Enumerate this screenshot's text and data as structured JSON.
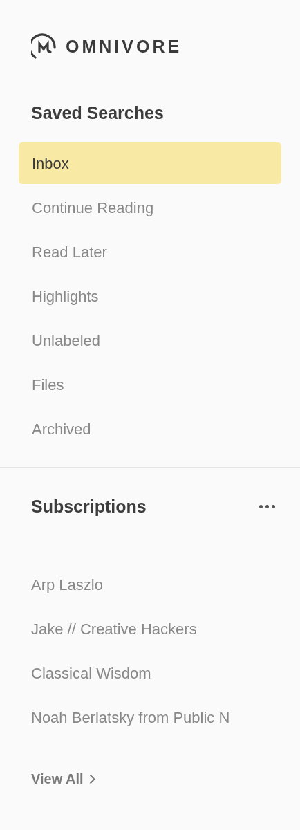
{
  "logo": {
    "text": "OMNIVORE"
  },
  "saved_searches": {
    "title": "Saved Searches",
    "items": [
      {
        "label": "Inbox",
        "selected": true
      },
      {
        "label": "Continue Reading",
        "selected": false
      },
      {
        "label": "Read Later",
        "selected": false
      },
      {
        "label": "Highlights",
        "selected": false
      },
      {
        "label": "Unlabeled",
        "selected": false
      },
      {
        "label": "Files",
        "selected": false
      },
      {
        "label": "Archived",
        "selected": false
      }
    ]
  },
  "subscriptions": {
    "title": "Subscriptions",
    "items": [
      {
        "label": "Arp Laszlo"
      },
      {
        "label": "Jake // Creative Hackers"
      },
      {
        "label": "Classical Wisdom"
      },
      {
        "label": "Noah Berlatsky from Public N"
      }
    ],
    "view_all": "View All"
  }
}
